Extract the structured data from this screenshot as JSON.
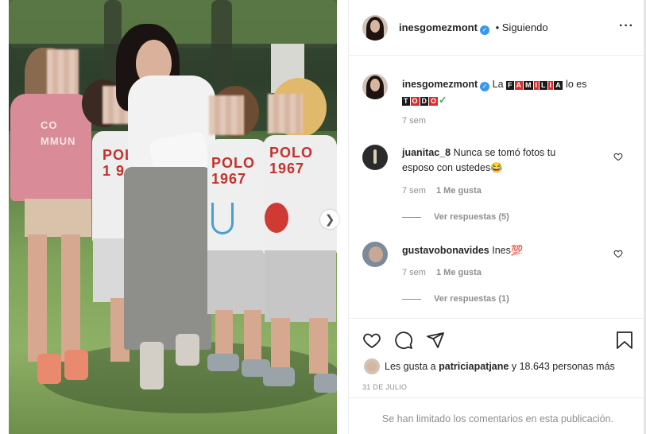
{
  "post": {
    "author": "inesgomezmont",
    "follow_status": "• Siguiendo",
    "more_icon": "more-horizontal-icon",
    "caption_prefix": "La",
    "caption_word1": [
      "F",
      "A",
      "M",
      "I",
      "L",
      "I",
      "A"
    ],
    "caption_middle": "lo es",
    "caption_word2": [
      "T",
      "O",
      "D",
      "O"
    ],
    "caption_suffix": "✓",
    "caption_time": "7 sem",
    "likes_text_prefix": "Les gusta a",
    "likes_user": "patriciapatjane",
    "likes_text_suffix": "y 18.643 personas más",
    "date": "31 DE JULIO",
    "comments_limited": "Se han limitado los comentarios en esta publicación."
  },
  "photo": {
    "shirt_text_left": "POLO\n1 9 6",
    "shirt_text_mid": "POLO\n1967",
    "shirt_text_right": "POLO\n1967",
    "shirt_text_girl": "CO\nMMUN"
  },
  "comments": [
    {
      "user": "juanitac_8",
      "text": "Nunca se tomó fotos tu esposo con ustedes😂",
      "time": "7 sem",
      "likes": "1 Me gusta",
      "replies": "Ver respuestas (5)"
    },
    {
      "user": "gustavobonavides",
      "text": "Ines💯",
      "time": "7 sem",
      "likes": "1 Me gusta",
      "replies": "Ver respuestas (1)"
    }
  ],
  "colors": {
    "verified": "#3897f0",
    "accent_red": "#d92c2c",
    "check_green": "#3bb54a",
    "border": "#efefef"
  }
}
